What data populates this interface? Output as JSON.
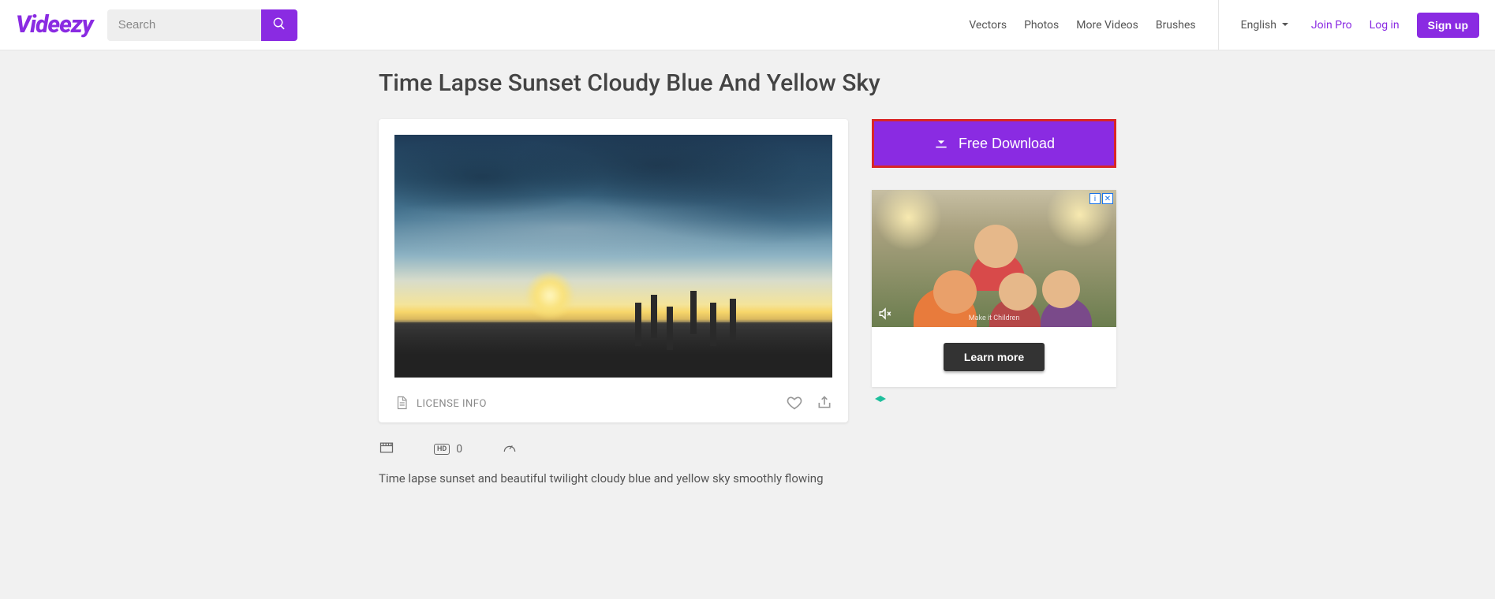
{
  "header": {
    "logo": "Videezy",
    "search_placeholder": "Search",
    "nav": {
      "vectors": "Vectors",
      "photos": "Photos",
      "more_videos": "More Videos",
      "brushes": "Brushes"
    },
    "language": "English",
    "join_pro": "Join Pro",
    "login": "Log in",
    "signup": "Sign up"
  },
  "page": {
    "title": "Time Lapse Sunset Cloudy Blue And Yellow Sky",
    "license_info": "LICENSE INFO",
    "hd_count": "0",
    "description": "Time lapse sunset and beautiful twilight cloudy blue and yellow sky smoothly flowing"
  },
  "sidebar": {
    "download_label": "Free Download",
    "ad_cta": "Learn more",
    "ad_caption": "Make it Children"
  }
}
